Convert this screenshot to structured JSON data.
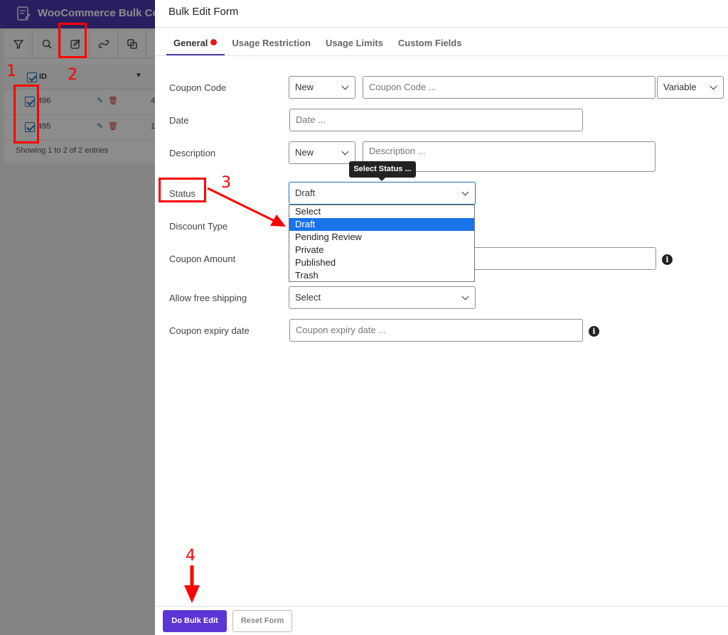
{
  "background": {
    "app_title": "WooCommerce Bulk Co",
    "table_header_id": "ID",
    "rows": [
      {
        "id": "496",
        "col2": "4"
      },
      {
        "id": "495",
        "col2": "1"
      }
    ],
    "entries_text": "Showing 1 to 2 of 2 entries"
  },
  "modal": {
    "title": "Bulk Edit Form",
    "tabs": [
      {
        "label": "General"
      },
      {
        "label": "Usage Restriction"
      },
      {
        "label": "Usage Limits"
      },
      {
        "label": "Custom Fields"
      }
    ],
    "fields": {
      "coupon_code": {
        "label": "Coupon Code",
        "mode": "New",
        "placeholder": "Coupon Code ...",
        "variant": "Variable"
      },
      "date": {
        "label": "Date",
        "placeholder": "Date ..."
      },
      "description": {
        "label": "Description",
        "mode": "New",
        "placeholder": "Description ..."
      },
      "status": {
        "label": "Status",
        "value": "Draft",
        "tooltip": "Select Status ...",
        "options": [
          "Select",
          "Draft",
          "Pending Review",
          "Private",
          "Published",
          "Trash"
        ],
        "selected_index": 1
      },
      "discount_type": {
        "label": "Discount Type"
      },
      "coupon_amount": {
        "label": "Coupon Amount"
      },
      "free_shipping": {
        "label": "Allow free shipping",
        "value": "Select"
      },
      "expiry": {
        "label": "Coupon expiry date",
        "placeholder": "Coupon expiry date ..."
      }
    },
    "buttons": {
      "bulk_edit": "Do Bulk Edit",
      "reset": "Reset Form"
    }
  },
  "annotations": [
    "1",
    "2",
    "3",
    "4"
  ],
  "colors": {
    "accent": "#4b3ab0",
    "button": "#5b35d5",
    "annotation": "#ff0000",
    "tab_dot": "#e81515",
    "option_highlight": "#1a73e8"
  },
  "icons": [
    "filter-icon",
    "search-icon",
    "edit-icon",
    "link-icon",
    "duplicate-icon",
    "pencil-icon",
    "trash-icon",
    "info-icon",
    "chevron-down-icon"
  ]
}
